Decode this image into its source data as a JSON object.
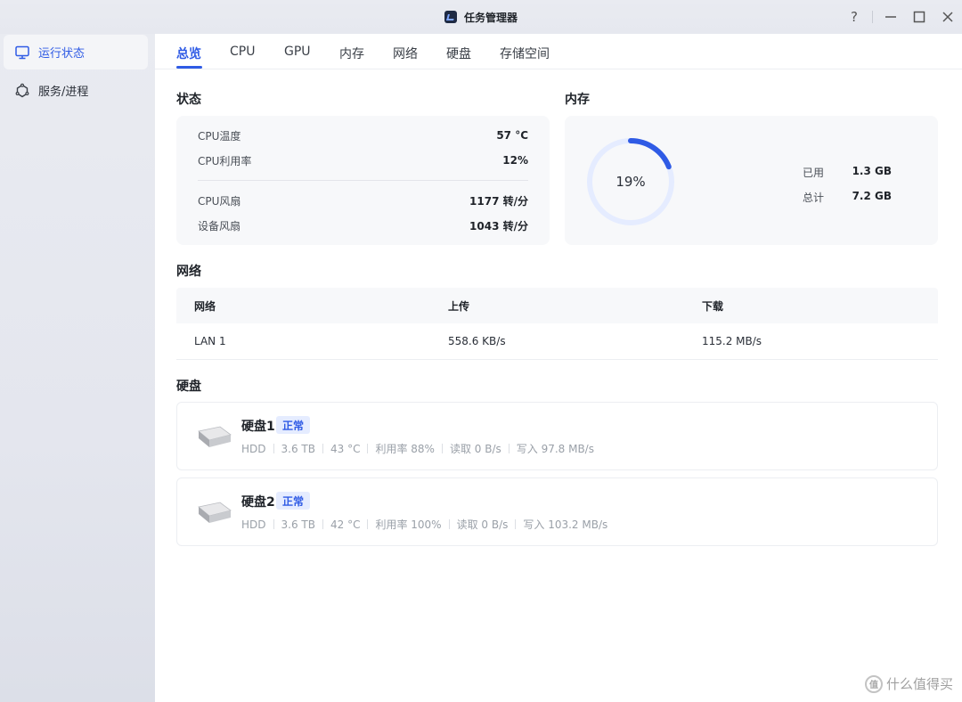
{
  "app": {
    "title": "任务管理器",
    "controls": {
      "help": "?",
      "minimize": "—",
      "maximize": "☐",
      "close": "✕"
    }
  },
  "sidebar": {
    "items": [
      {
        "label": "运行状态",
        "icon": "monitor-icon",
        "active": true
      },
      {
        "label": "服务/进程",
        "icon": "services-icon",
        "active": false
      }
    ]
  },
  "tabs": [
    {
      "label": "总览",
      "active": true
    },
    {
      "label": "CPU"
    },
    {
      "label": "GPU"
    },
    {
      "label": "内存"
    },
    {
      "label": "网络"
    },
    {
      "label": "硬盘"
    },
    {
      "label": "存储空间"
    }
  ],
  "status": {
    "title": "状态",
    "rows": [
      {
        "label": "CPU温度",
        "value": "57 °C"
      },
      {
        "label": "CPU利用率",
        "value": "12%"
      },
      {
        "label": "CPU风扇",
        "value": "1177 转/分"
      },
      {
        "label": "设备风扇",
        "value": "1043 转/分"
      }
    ]
  },
  "memory": {
    "title": "内存",
    "percent_label": "19%",
    "percent": 0.19,
    "used_label": "已用",
    "used_value": "1.3 GB",
    "total_label": "总计",
    "total_value": "7.2 GB"
  },
  "network": {
    "title": "网络",
    "headers": [
      "网络",
      "上传",
      "下载"
    ],
    "rows": [
      [
        "LAN 1",
        "558.6 KB/s",
        "115.2 MB/s"
      ]
    ]
  },
  "disks": {
    "title": "硬盘",
    "items": [
      {
        "name": "硬盘1",
        "status": "正常",
        "meta": [
          "HDD",
          "3.6 TB",
          "43 °C",
          "利用率 88%",
          "读取 0 B/s",
          "写入 97.8 MB/s"
        ]
      },
      {
        "name": "硬盘2",
        "status": "正常",
        "meta": [
          "HDD",
          "3.6 TB",
          "42 °C",
          "利用率 100%",
          "读取 0 B/s",
          "写入 103.2 MB/s"
        ]
      }
    ]
  },
  "watermark": {
    "text": "什么值得买",
    "icon_text": "值"
  },
  "colors": {
    "accent": "#2f5be5",
    "gauge_track": "#e5ecff",
    "badge_bg": "#e5ecff"
  }
}
